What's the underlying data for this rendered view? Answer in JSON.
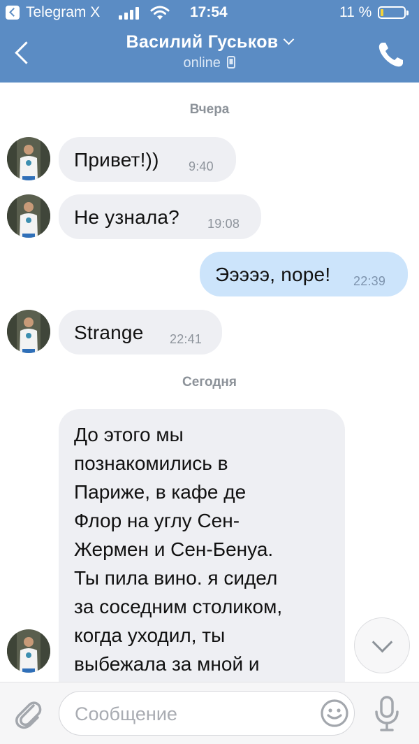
{
  "status_bar": {
    "app": "Telegram X",
    "time": "17:54",
    "battery": "11 %",
    "battery_level": 0.11
  },
  "header": {
    "title": "Василий Гуськов",
    "status": "online",
    "back_icon": "chevron-left-icon",
    "call_icon": "phone-icon",
    "bg_color": "#5b8cc4"
  },
  "chat": {
    "date_yesterday": "Вчера",
    "date_today": "Сегодня",
    "messages": [
      {
        "dir": "in",
        "text": "Привет!))",
        "time": "9:40"
      },
      {
        "dir": "in",
        "text": "Не узнала?",
        "time": "19:08"
      },
      {
        "dir": "out",
        "text": "Эээээ, nope!",
        "time": "22:39"
      },
      {
        "dir": "in",
        "text": "Strange",
        "time": "22:41"
      }
    ],
    "long_message": {
      "dir": "in",
      "lines": [
        "До этого мы",
        "познакомились в",
        "Париже, в кафе де",
        "Флор на углу Сен-",
        "Жермен и Сен-Бенуа.",
        "Ты пила вино. я сидел",
        "за соседним столиком,",
        "когда уходил, ты",
        "выбежала за мной и"
      ]
    },
    "incoming_bubble_color": "#eeeff3",
    "outgoing_bubble_color": "#cce4fb"
  },
  "input_bar": {
    "placeholder": "Сообщение",
    "attach_icon": "paperclip-icon",
    "emoji_icon": "smiley-icon",
    "mic_icon": "microphone-icon"
  }
}
